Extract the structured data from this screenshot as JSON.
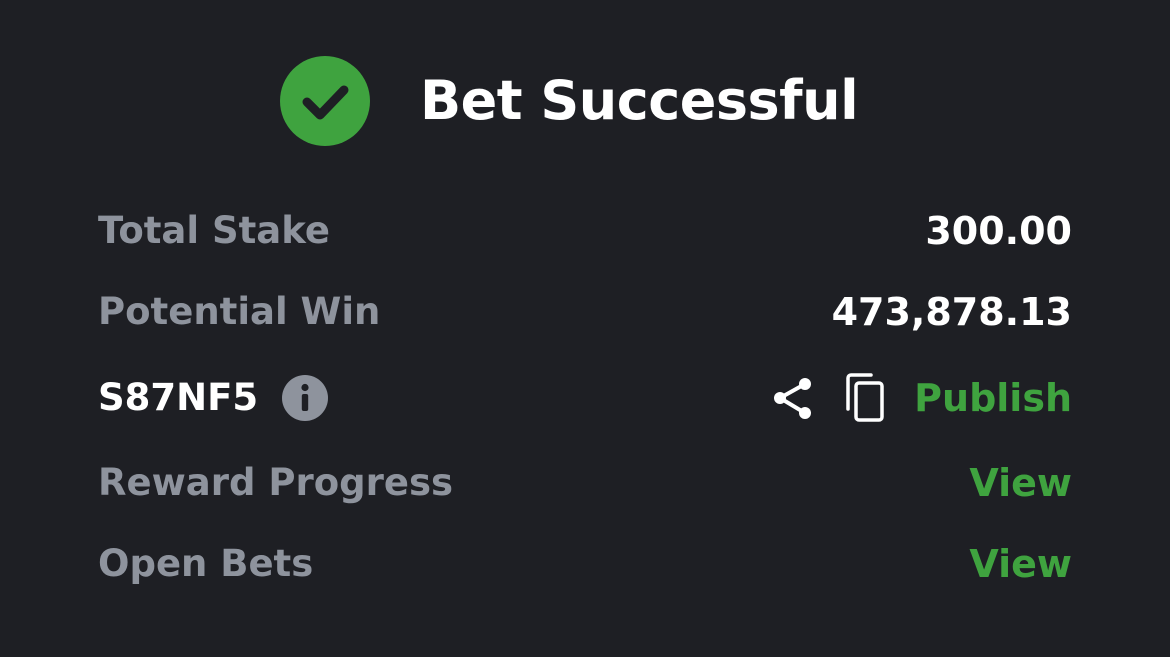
{
  "header": {
    "title": "Bet Successful",
    "icon": "check-circle-icon",
    "accent_color": "#3fa33f"
  },
  "summary": {
    "total_stake_label": "Total Stake",
    "total_stake_value": "300.00",
    "potential_win_label": "Potential Win",
    "potential_win_value": "473,878.13",
    "booking_code": "S87NF5",
    "publish_label": "Publish",
    "reward_progress_label": "Reward Progress",
    "reward_progress_link": "View",
    "open_bets_label": "Open Bets",
    "open_bets_link": "View"
  },
  "icons": {
    "info": "info-icon",
    "share": "share-icon",
    "copy": "copy-icon"
  },
  "colors": {
    "background": "#1e1f24",
    "label": "#8e939d",
    "value": "#ffffff",
    "link": "#3fa33f"
  }
}
